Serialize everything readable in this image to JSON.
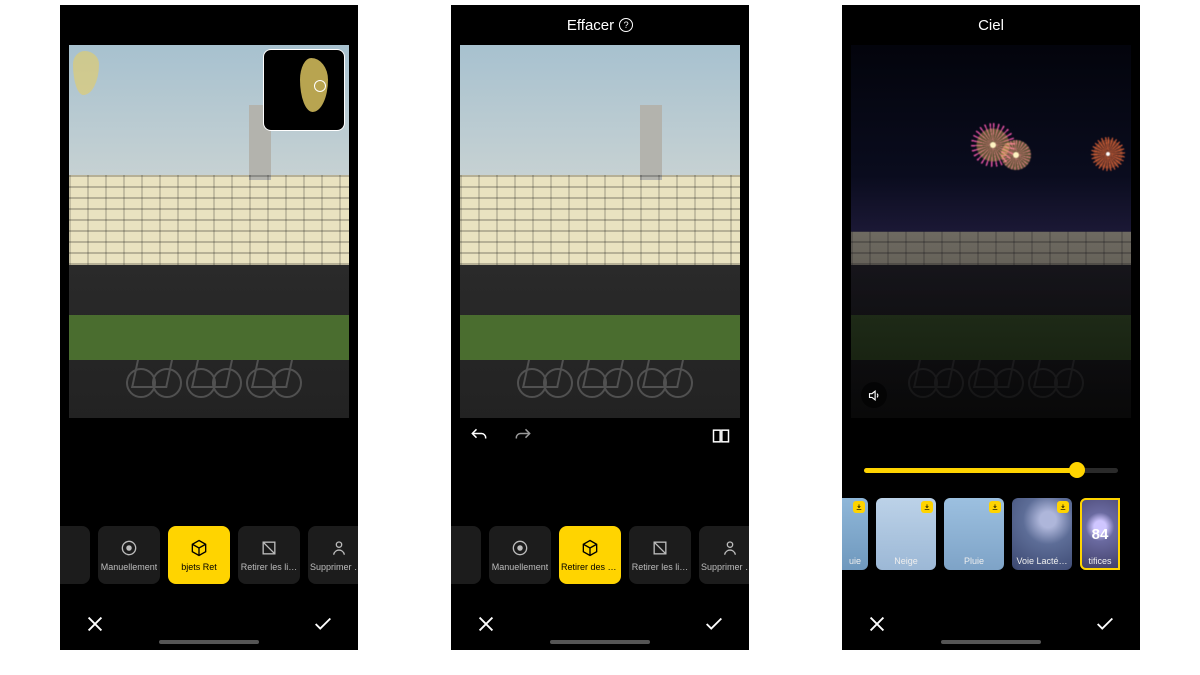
{
  "colors": {
    "accent": "#ffd400"
  },
  "screen1": {
    "title": "",
    "tools": [
      {
        "label": "Manuellement",
        "icon": "target-icon"
      },
      {
        "label": "bjets    Ret",
        "icon": "cube-icon",
        "selected": true
      },
      {
        "label": "Retirer les li…",
        "icon": "crop-icon"
      },
      {
        "label": "Supprimer d…",
        "icon": "person-icon"
      }
    ]
  },
  "screen2": {
    "title": "Effacer",
    "tools": [
      {
        "label": "Manuellement",
        "icon": "target-icon"
      },
      {
        "label": "Retirer des ob…",
        "icon": "cube-icon",
        "selected": true
      },
      {
        "label": "Retirer les li…",
        "icon": "crop-icon"
      },
      {
        "label": "Supprimer d…",
        "icon": "person-icon"
      }
    ]
  },
  "screen3": {
    "title": "Ciel",
    "slider": {
      "value": 84,
      "min": 0,
      "max": 100
    },
    "thumbs": [
      {
        "label": "uie",
        "download": true,
        "bg": "#8fb7d9"
      },
      {
        "label": "Neige",
        "download": true,
        "bg": "#a9c2df"
      },
      {
        "label": "Pluie",
        "download": true,
        "bg": "#8fb4d6"
      },
      {
        "label": "Voie Lacté…",
        "download": true,
        "bg": "#5d6d97"
      },
      {
        "label": "tifices",
        "download": false,
        "selected": true,
        "bg": "#4c4a7a",
        "value": "84"
      }
    ]
  }
}
